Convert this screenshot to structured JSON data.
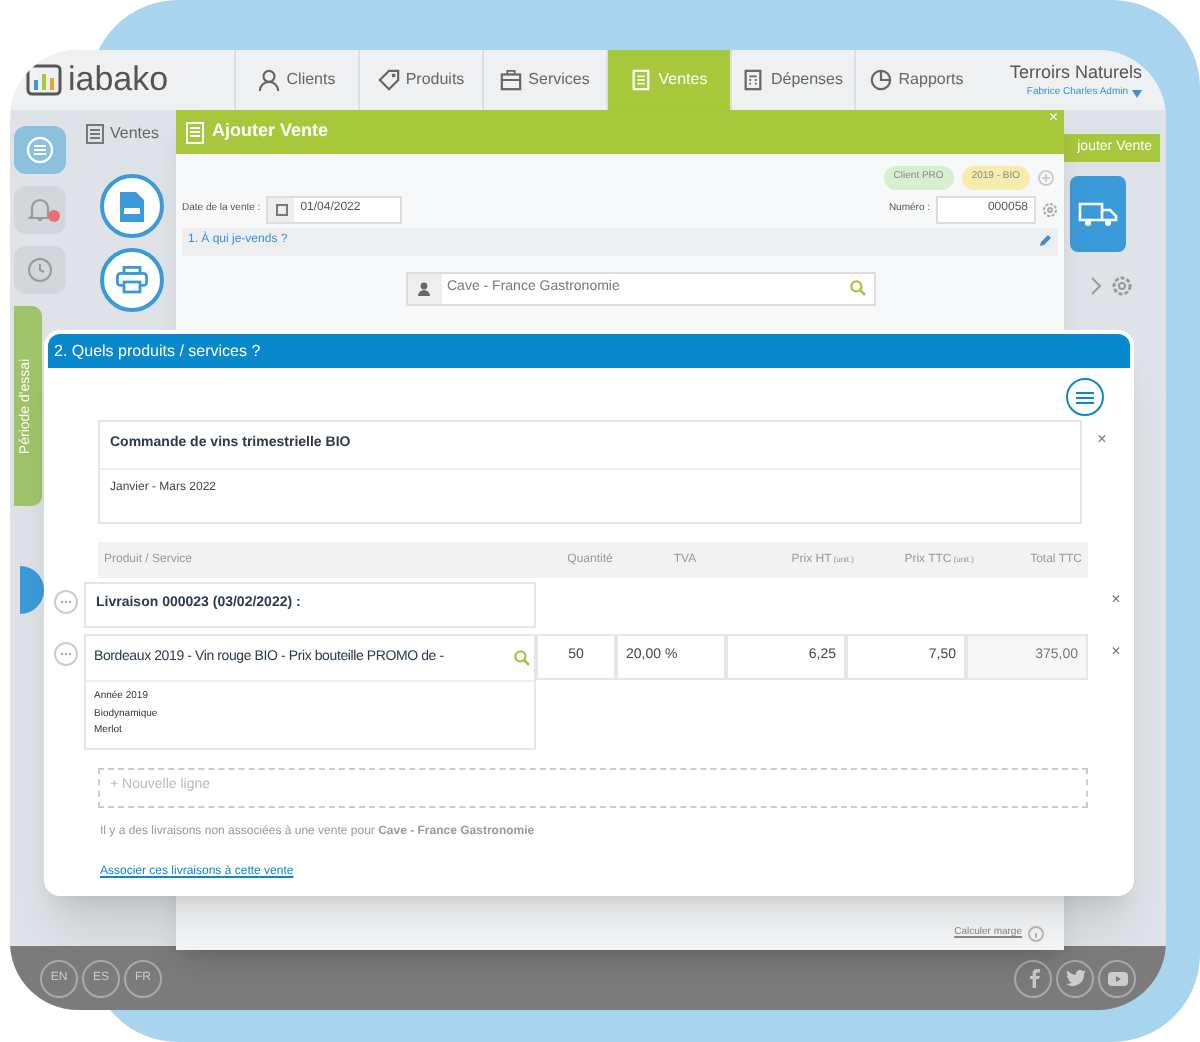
{
  "app": {
    "logo": "iabako",
    "company": "Terroirs Naturels",
    "user": "Fabrice Charles Admin",
    "nav": [
      {
        "label": "Clients",
        "selected": false
      },
      {
        "label": "Produits",
        "selected": false
      },
      {
        "label": "Services",
        "selected": false
      },
      {
        "label": "Ventes",
        "selected": true
      },
      {
        "label": "Dépenses",
        "selected": false
      },
      {
        "label": "Rapports",
        "selected": false
      }
    ],
    "page_title": "Ventes",
    "trial": "Période d'essai",
    "add_button": "jouter Vente",
    "margin_link": "Calculer marge",
    "languages": [
      "EN",
      "ES",
      "FR"
    ]
  },
  "modal": {
    "title": "Ajouter Vente",
    "close": "×",
    "tags": [
      {
        "label": "Client PRO",
        "color": "#d6efcf"
      },
      {
        "label": "2019 - BIO",
        "color": "#f6ecac"
      }
    ],
    "date_label": "Date de la vente :",
    "date": "01/04/2022",
    "number_label": "Numéro :",
    "number": "000058",
    "section_1": "1. À qui je-vends ?",
    "client": "Cave - France Gastronomie"
  },
  "products": {
    "title": "2. Quels produits / services ?",
    "order_close": "×",
    "order_title": "Commande de vins trimestrielle BIO",
    "order_period": "Janvier - Mars 2022",
    "columns": [
      {
        "label": "Produit / Service"
      },
      {
        "label": "Quantité"
      },
      {
        "label": "TVA"
      },
      {
        "label": "Prix HT",
        "unit": "(unit.)"
      },
      {
        "label": "Prix TTC",
        "unit": "(unit.)"
      },
      {
        "label": "Total TTC"
      }
    ],
    "rows": [
      {
        "kind": "group",
        "label": "Livraison 000023 (03/02/2022) :",
        "delete": "×"
      },
      {
        "kind": "item",
        "product": "Bordeaux 2019 - Vin rouge BIO - Prix bouteille PROMO de -",
        "quantity": "50",
        "vat": "20,00 %",
        "price_ht": "6,25",
        "price_ttc": "7,50",
        "total": "375,00",
        "delete": "×",
        "details": [
          "Année 2019",
          "Biodynamique",
          "Merlot"
        ]
      }
    ],
    "new_line": "+ Nouvelle ligne",
    "note": "Il y a des livraisons non associées à une vente pour **Cave - France Gastronomie**",
    "link": "Associer ces livraisons à cette vente"
  }
}
